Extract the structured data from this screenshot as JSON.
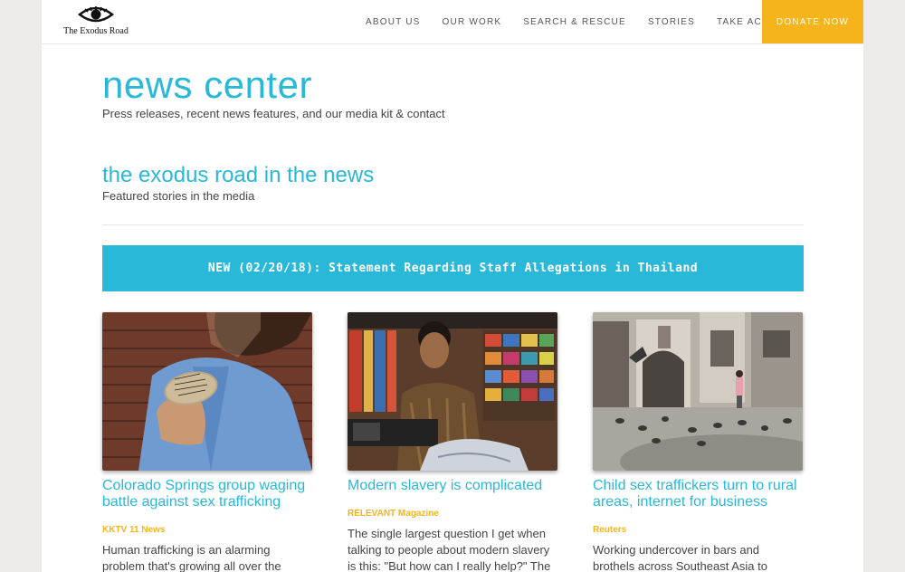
{
  "header": {
    "logo_text": "The Exodus Road",
    "nav": [
      "ABOUT US",
      "OUR WORK",
      "SEARCH & RESCUE",
      "STORIES",
      "TAKE ACTION"
    ],
    "donate_label": "DONATE NOW"
  },
  "hero": {
    "title": "news center",
    "subtitle": "Press releases, recent news features, and our media kit & contact"
  },
  "section": {
    "title": "the exodus road in the news",
    "subtitle": "Featured stories in the media"
  },
  "banner": {
    "text": "NEW (02/20/18): Statement Regarding Staff Allegations in Thailand"
  },
  "cards": [
    {
      "title": "Colorado Springs group waging battle against sex trafficking",
      "source": "KKTV 11 News",
      "excerpt": "Human trafficking is an alarming problem that's growing all over the"
    },
    {
      "title": "Modern slavery is complicated",
      "source": "RELEVANT Magazine",
      "excerpt": "The single largest question I get when talking to people about modern slavery is this: \"But how can I really help?\" The problem feels both far away, incredibly"
    },
    {
      "title": "Child sex traffickers turn to rural areas, internet for business",
      "source": "Reuters",
      "excerpt": "Working undercover in bars and brothels across Southeast Asia to"
    }
  ],
  "colors": {
    "accent": "#29b8d8",
    "donate": "#f5b41c",
    "source": "#f5b41c"
  }
}
